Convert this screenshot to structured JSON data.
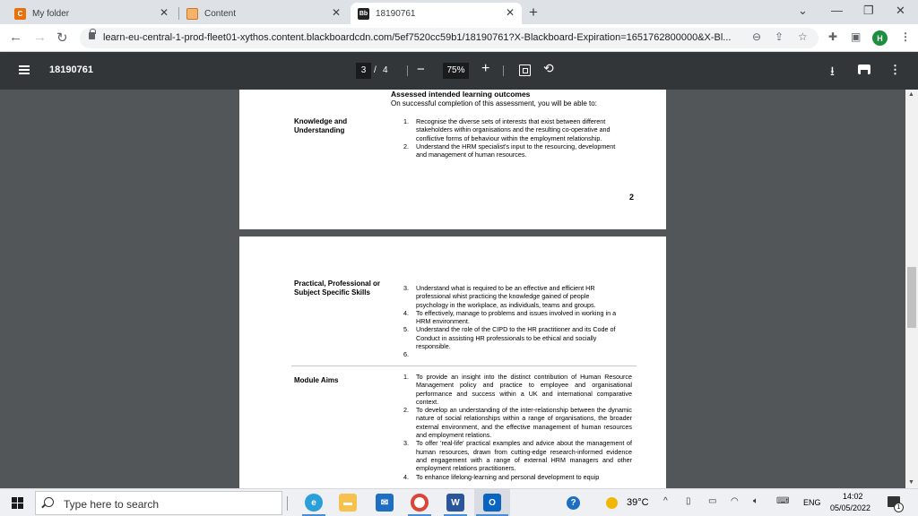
{
  "browser": {
    "tabs": [
      {
        "label": "My folder",
        "favicon_letter": "C",
        "favicon_color": "#e8710a"
      },
      {
        "label": "Content",
        "favicon_letter": "",
        "favicon_color": "#f6b26b"
      },
      {
        "label": "18190761",
        "favicon_letter": "Bb",
        "favicon_color": "#222222"
      }
    ],
    "new_tab": "+",
    "url": "learn-eu-central-1-prod-fleet01-xythos.content.blackboardcdn.com/5ef7520cc59b1/18190761?X-Blackboard-Expiration=1651762800000&X-Bl...",
    "profile_initial": "H",
    "profile_color": "#1e8e3e"
  },
  "pdf_toolbar": {
    "title": "18190761",
    "current_page": "3",
    "separator": "/",
    "total_pages": "4",
    "zoom": "75%"
  },
  "document": {
    "page1": {
      "heading": "Assessed intended learning outcomes",
      "intro": "On successful completion of this assessment, you will be able to:",
      "knowledge_label": "Knowledge and Understanding",
      "items": [
        {
          "num": "1.",
          "text": "Recognise the diverse sets of interests that exist between different stakeholders within organisations and the resulting co-operative and conflictive forms of behaviour within the employment relationship."
        },
        {
          "num": "2.",
          "text": "Understand the HRM specialist's input to the resourcing, development and management of human resources."
        }
      ],
      "page_number": "2"
    },
    "page2": {
      "skills_label": "Practical, Professional or Subject Specific Skills",
      "skills_items": [
        {
          "num": "3.",
          "text": "Understand what is required to be an effective and efficient HR professional whist practicing the knowledge gained of people psychology in the workplace, as individuals, teams and groups."
        },
        {
          "num": "4.",
          "text": "To effectively, manage to problems and issues involved in working in a HRM environment."
        },
        {
          "num": "5.",
          "text": "Understand the role of the CIPD to the HR practitioner and its Code of Conduct in assisting HR professionals to be ethical and socially responsible."
        },
        {
          "num": "6.",
          "text": ""
        }
      ],
      "aims_label": "Module Aims",
      "aims_items": [
        {
          "num": "1.",
          "text": "To provide an insight into the distinct contribution of Human Resource Management policy and practice to employee and organisational performance and success within a UK and international comparative context."
        },
        {
          "num": "2.",
          "text": "To develop an understanding of the inter-relationship between the dynamic nature of social relationships within a range of organisations, the broader external environment, and the effective management of human resources and employment relations."
        },
        {
          "num": "3.",
          "text": "To offer 'real-life' practical examples and advice about the management of human resources, drawn from cutting-edge research-informed evidence and engagement with a range of external HRM managers and other employment relations practitioners."
        },
        {
          "num": "4.",
          "text": "To enhance lifelong-learning and personal development to equip"
        }
      ]
    }
  },
  "taskbar": {
    "search_placeholder": "Type here to search",
    "temperature": "39°C",
    "language": "ENG",
    "time": "14:02",
    "date": "05/05/2022",
    "notification_count": "1"
  }
}
